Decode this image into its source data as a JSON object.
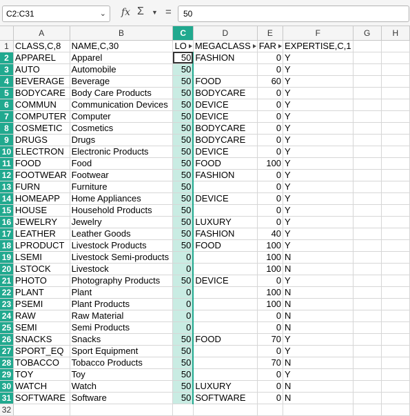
{
  "formula_bar": {
    "name_box": "C2:C31",
    "fx_icon": "fx",
    "sum_icon": "Σ",
    "equals_icon": "=",
    "formula_value": "50"
  },
  "columns": [
    "A",
    "B",
    "C",
    "D",
    "E",
    "F",
    "G",
    "H"
  ],
  "header_row": {
    "num": "1",
    "a": "CLASS,C,8",
    "b": "NAME,C,30",
    "c": "LO",
    "d": "MEGACLASS",
    "e": "FAR",
    "f": "EXPERTISE,C,1"
  },
  "rows": [
    {
      "num": "2",
      "a": "APPAREL",
      "b": "Apparel",
      "c": "50",
      "d": "FASHION",
      "e": "0",
      "f": "Y"
    },
    {
      "num": "3",
      "a": "AUTO",
      "b": "Automobile",
      "c": "50",
      "d": "",
      "e": "0",
      "f": "Y"
    },
    {
      "num": "4",
      "a": "BEVERAGE",
      "b": "Beverage",
      "c": "50",
      "d": "FOOD",
      "e": "60",
      "f": "Y"
    },
    {
      "num": "5",
      "a": "BODYCARE",
      "b": "Body Care Products",
      "c": "50",
      "d": "BODYCARE",
      "e": "0",
      "f": "Y"
    },
    {
      "num": "6",
      "a": "COMMUN",
      "b": "Communication Devices",
      "c": "50",
      "d": "DEVICE",
      "e": "0",
      "f": "Y"
    },
    {
      "num": "7",
      "a": "COMPUTER",
      "b": "Computer",
      "c": "50",
      "d": "DEVICE",
      "e": "0",
      "f": "Y"
    },
    {
      "num": "8",
      "a": "COSMETIC",
      "b": "Cosmetics",
      "c": "50",
      "d": "BODYCARE",
      "e": "0",
      "f": "Y"
    },
    {
      "num": "9",
      "a": "DRUGS",
      "b": "Drugs",
      "c": "50",
      "d": "BODYCARE",
      "e": "0",
      "f": "Y"
    },
    {
      "num": "10",
      "a": "ELECTRON",
      "b": "Electronic Products",
      "c": "50",
      "d": "DEVICE",
      "e": "0",
      "f": "Y"
    },
    {
      "num": "11",
      "a": "FOOD",
      "b": "Food",
      "c": "50",
      "d": "FOOD",
      "e": "100",
      "f": "Y"
    },
    {
      "num": "12",
      "a": "FOOTWEAR",
      "b": "Footwear",
      "c": "50",
      "d": "FASHION",
      "e": "0",
      "f": "Y"
    },
    {
      "num": "13",
      "a": "FURN",
      "b": "Furniture",
      "c": "50",
      "d": "",
      "e": "0",
      "f": "Y"
    },
    {
      "num": "14",
      "a": "HOMEAPP",
      "b": "Home Appliances",
      "c": "50",
      "d": "DEVICE",
      "e": "0",
      "f": "Y"
    },
    {
      "num": "15",
      "a": "HOUSE",
      "b": "Household Products",
      "c": "50",
      "d": "",
      "e": "0",
      "f": "Y"
    },
    {
      "num": "16",
      "a": "JEWELRY",
      "b": "Jewelry",
      "c": "50",
      "d": "LUXURY",
      "e": "0",
      "f": "Y"
    },
    {
      "num": "17",
      "a": "LEATHER",
      "b": "Leather Goods",
      "c": "50",
      "d": "FASHION",
      "e": "40",
      "f": "Y"
    },
    {
      "num": "18",
      "a": "LPRODUCT",
      "b": "Livestock Products",
      "c": "50",
      "d": "FOOD",
      "e": "100",
      "f": "Y"
    },
    {
      "num": "19",
      "a": "LSEMI",
      "b": "Livestock Semi-products",
      "c": "0",
      "d": "",
      "e": "100",
      "f": "N"
    },
    {
      "num": "20",
      "a": "LSTOCK",
      "b": "Livestock",
      "c": "0",
      "d": "",
      "e": "100",
      "f": "N"
    },
    {
      "num": "21",
      "a": "PHOTO",
      "b": "Photography Products",
      "c": "50",
      "d": "DEVICE",
      "e": "0",
      "f": "Y"
    },
    {
      "num": "22",
      "a": "PLANT",
      "b": "Plant",
      "c": "0",
      "d": "",
      "e": "100",
      "f": "N"
    },
    {
      "num": "23",
      "a": "PSEMI",
      "b": "Plant Products",
      "c": "0",
      "d": "",
      "e": "100",
      "f": "N"
    },
    {
      "num": "24",
      "a": "RAW",
      "b": "Raw Material",
      "c": "0",
      "d": "",
      "e": "0",
      "f": "N"
    },
    {
      "num": "25",
      "a": "SEMI",
      "b": "Semi Products",
      "c": "0",
      "d": "",
      "e": "0",
      "f": "N"
    },
    {
      "num": "26",
      "a": "SNACKS",
      "b": "Snacks",
      "c": "50",
      "d": "FOOD",
      "e": "70",
      "f": "Y"
    },
    {
      "num": "27",
      "a": "SPORT_EQ",
      "b": "Sport Equipment",
      "c": "50",
      "d": "",
      "e": "0",
      "f": "Y"
    },
    {
      "num": "28",
      "a": "TOBACCO",
      "b": "Tobacco Products",
      "c": "50",
      "d": "",
      "e": "70",
      "f": "N"
    },
    {
      "num": "29",
      "a": "TOY",
      "b": "Toy",
      "c": "50",
      "d": "",
      "e": "0",
      "f": "Y"
    },
    {
      "num": "30",
      "a": "WATCH",
      "b": "Watch",
      "c": "50",
      "d": "LUXURY",
      "e": "0",
      "f": "N"
    },
    {
      "num": "31",
      "a": "SOFTWARE",
      "b": "Software",
      "c": "50",
      "d": "SOFTWARE",
      "e": "0",
      "f": "N"
    }
  ],
  "last_row_num": "32",
  "colors": {
    "selection_header": "#21a98f",
    "selection_fill": "#c9ece3"
  }
}
